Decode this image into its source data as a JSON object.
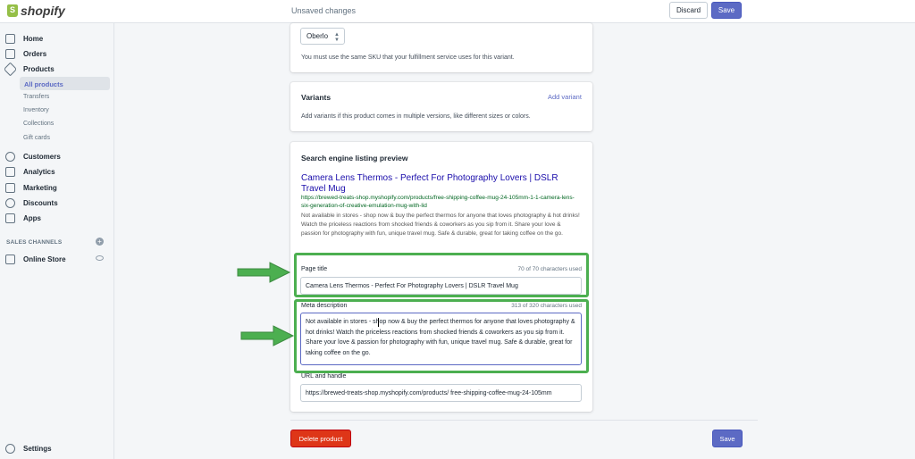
{
  "topbar": {
    "logo_text": "shopify",
    "status": "Unsaved changes",
    "discard_label": "Discard",
    "save_label": "Save"
  },
  "sidebar": {
    "items": [
      {
        "label": "Home",
        "icon": "home-icon"
      },
      {
        "label": "Orders",
        "icon": "orders-icon"
      },
      {
        "label": "Products",
        "icon": "tag-icon"
      },
      {
        "label": "Customers",
        "icon": "person-icon"
      },
      {
        "label": "Analytics",
        "icon": "bar-chart-icon"
      },
      {
        "label": "Marketing",
        "icon": "megaphone-icon"
      },
      {
        "label": "Discounts",
        "icon": "discount-icon"
      },
      {
        "label": "Apps",
        "icon": "apps-icon"
      }
    ],
    "product_subitems": [
      "All products",
      "Transfers",
      "Inventory",
      "Collections",
      "Gift cards"
    ],
    "sales_channels_heading": "SALES CHANNELS",
    "online_store": "Online Store",
    "settings": "Settings"
  },
  "inventory_card": {
    "fulfillment_select": "Oberlo",
    "help_text": "You must use the same SKU that your fulfillment service uses for this variant."
  },
  "variants_card": {
    "title": "Variants",
    "add_variant": "Add variant",
    "help_text": "Add variants if this product comes in multiple versions, like different sizes or colors."
  },
  "seo_card": {
    "title": "Search engine listing preview",
    "preview_title": "Camera Lens Thermos - Perfect For Photography Lovers | DSLR Travel Mug",
    "preview_url": "https://brewed-treats-shop.myshopify.com/products/free-shipping-coffee-mug-24-105mm-1-1-camera-lens-six-generation-of-creative-emulation-mug-with-lid",
    "preview_description": "Not available in stores - shop now & buy the perfect thermos for anyone that loves photography & hot drinks! Watch the priceless reactions from shocked friends & coworkers as you sip from it. Share your love & passion for photography with fun, unique travel mug. Safe & durable, great for taking coffee on the go.",
    "page_title_label": "Page title",
    "page_title_counter": "70 of 70 characters used",
    "page_title_value": "Camera Lens Thermos - Perfect For Photography Lovers | DSLR Travel Mug",
    "meta_label": "Meta description",
    "meta_counter": "313 of 320 characters used",
    "meta_value": "Not available in stores - shop now & buy the perfect thermos for anyone that loves photography & hot drinks! Watch the priceless reactions from shocked friends & coworkers as you sip from it. Share your love & passion for photography with fun, unique travel mug. Safe & durable, great for taking coffee on the go.",
    "url_label": "URL and handle",
    "url_value": "https://brewed-treats-shop.myshopify.com/products/ free-shipping-coffee-mug-24-105mm"
  },
  "footer": {
    "delete_label": "Delete product",
    "save_label": "Save"
  },
  "colors": {
    "accent": "#5c6ac4",
    "highlight": "#4caf50",
    "danger": "#de3618"
  }
}
